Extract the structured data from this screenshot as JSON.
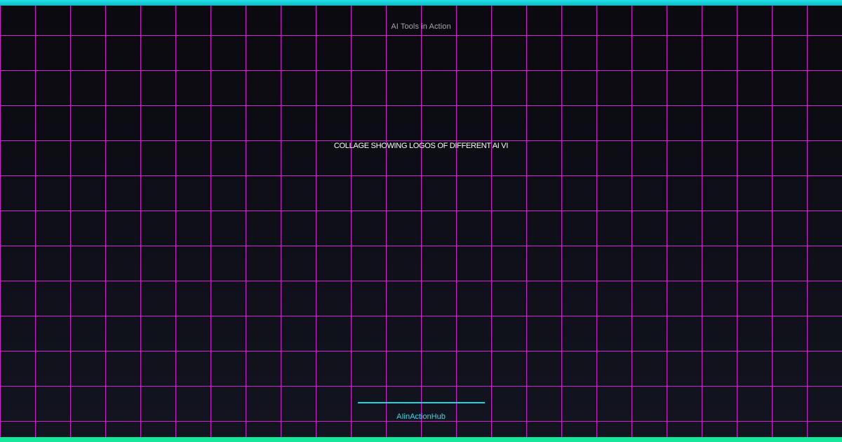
{
  "tag_text": "AI Tools in Action",
  "headline_text": "COLLAGE SHOWING LOGOS OF DIFFERENT AI VI",
  "brand_text": "AIinActionHub",
  "colors": {
    "background_top": "#0a0a0f",
    "background_bottom": "#12141f",
    "grid_line": "#d21fd2",
    "top_bar": "#20e3e8",
    "bottom_bar": "#14e69a",
    "divider": "#1fd2e0",
    "brand_text": "#2ee0ea",
    "tag_text": "#a6a6ad",
    "headline_text": "#ffffff"
  }
}
